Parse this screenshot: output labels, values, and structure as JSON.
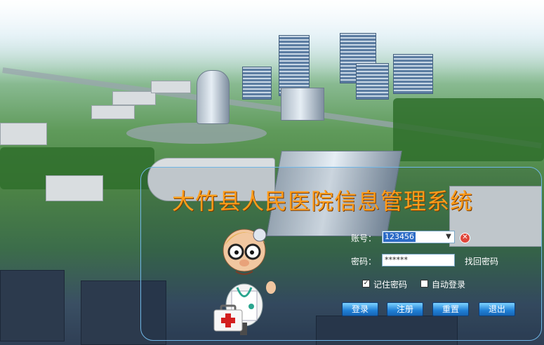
{
  "window": {
    "title": "大竹县人民医院信息管理系统"
  },
  "login": {
    "account_label": "账号：",
    "account_value": "123456",
    "password_label": "密码：",
    "password_value": "******",
    "forgot_password": "找回密码",
    "remember_password": "记住密码",
    "remember_checked": true,
    "auto_login": "自动登录",
    "auto_login_checked": false
  },
  "buttons": {
    "login": "登录",
    "register": "注册",
    "reset": "重置",
    "exit": "退出"
  },
  "icons": {
    "clear": "clear-icon",
    "dropdown": "chevron-down-icon",
    "mascot": "doctor-mascot",
    "first_aid": "first-aid-kit-icon"
  },
  "colors": {
    "title": "#ff9c1a",
    "panel_border": "#6fb6e6",
    "button": "#1f7fd6",
    "clear_icon": "#e0463a"
  }
}
